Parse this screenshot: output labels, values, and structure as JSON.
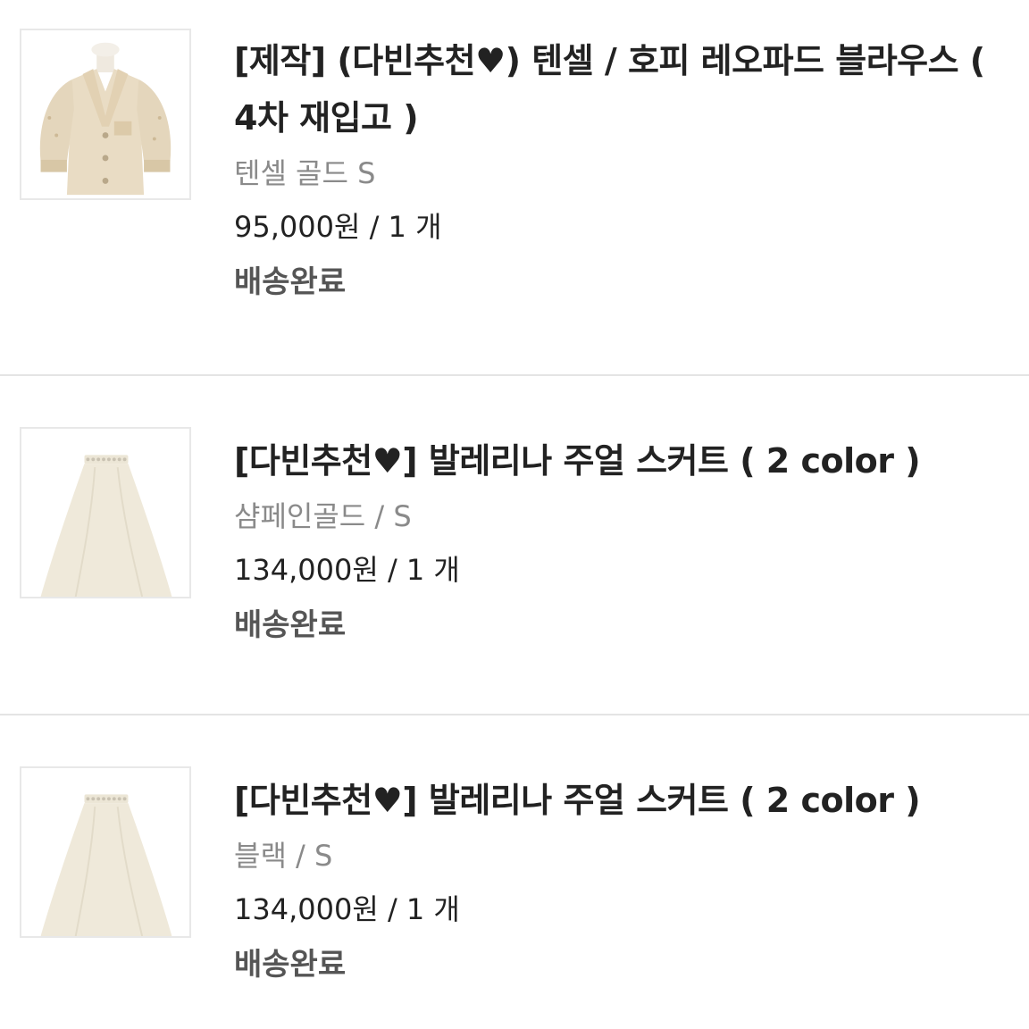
{
  "orders": [
    {
      "title": "[제작] (다빈추천♥) 텐셀 / 호피 레오파드 블라우스 ( 4차 재입고 )",
      "option": "텐셀 골드 S",
      "price": "95,000원 / 1 개",
      "status": "배송완료",
      "image_icon": "blouse-product-image"
    },
    {
      "title": "[다빈추천♥] 발레리나 주얼 스커트 ( 2 color )",
      "option": "샴페인골드 / S",
      "price": "134,000원 / 1 개",
      "status": "배송완료",
      "image_icon": "skirt-product-image"
    },
    {
      "title": "[다빈추천♥] 발레리나 주얼 스커트 ( 2 color )",
      "option": "블랙 / S",
      "price": "134,000원 / 1 개",
      "status": "배송완료",
      "image_icon": "skirt-product-image"
    }
  ],
  "colors": {
    "title": "#222222",
    "option": "#8a8a8a",
    "price": "#222222",
    "status": "#555555",
    "divider": "#e4e4e4"
  }
}
